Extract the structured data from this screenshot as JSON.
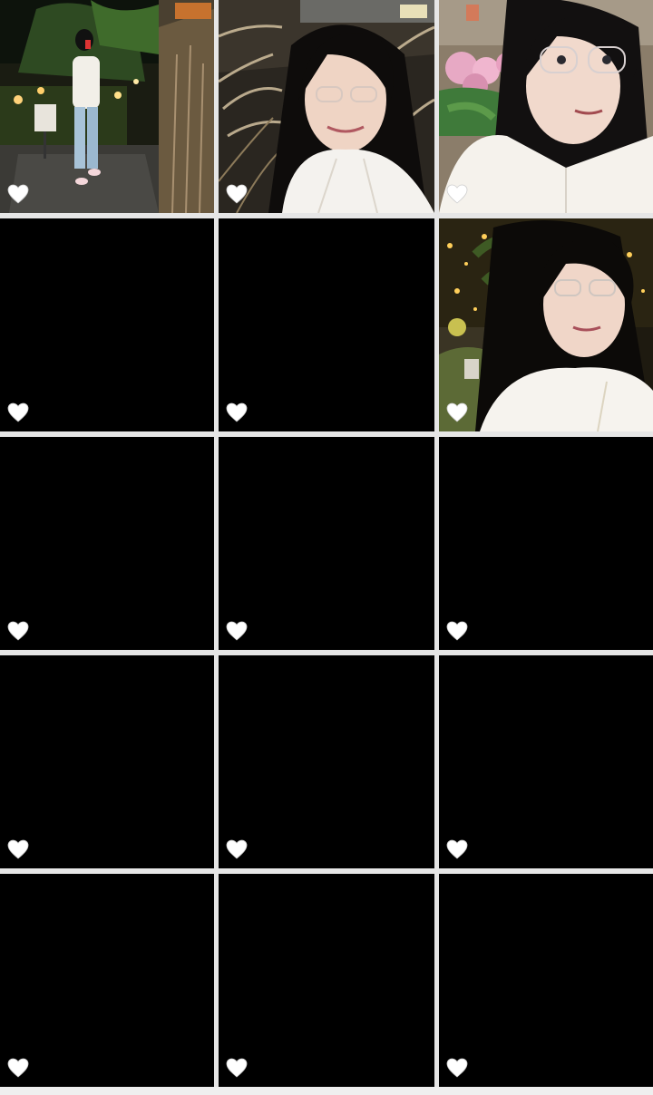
{
  "gallery": {
    "columns": 3,
    "rows": 5,
    "items": [
      {
        "kind": "photo",
        "scene": "night-garden-full-body",
        "liked": false
      },
      {
        "kind": "photo",
        "scene": "selfie-pampas-grass",
        "liked": false
      },
      {
        "kind": "photo",
        "scene": "selfie-hydrangea",
        "liked": false
      },
      {
        "kind": "blank",
        "liked": false
      },
      {
        "kind": "blank",
        "liked": false
      },
      {
        "kind": "photo",
        "scene": "selfie-night-lights",
        "liked": false
      },
      {
        "kind": "blank",
        "liked": false
      },
      {
        "kind": "blank",
        "liked": false
      },
      {
        "kind": "blank",
        "liked": false
      },
      {
        "kind": "blank",
        "liked": false
      },
      {
        "kind": "blank",
        "liked": false
      },
      {
        "kind": "blank",
        "liked": false
      },
      {
        "kind": "blank",
        "liked": false
      },
      {
        "kind": "blank",
        "liked": false
      },
      {
        "kind": "blank",
        "liked": false
      }
    ],
    "heart_icon": "heart-icon",
    "heart_color": "#ffffff",
    "tile_color": "#000000",
    "divider_color": "#e6e6e6"
  }
}
